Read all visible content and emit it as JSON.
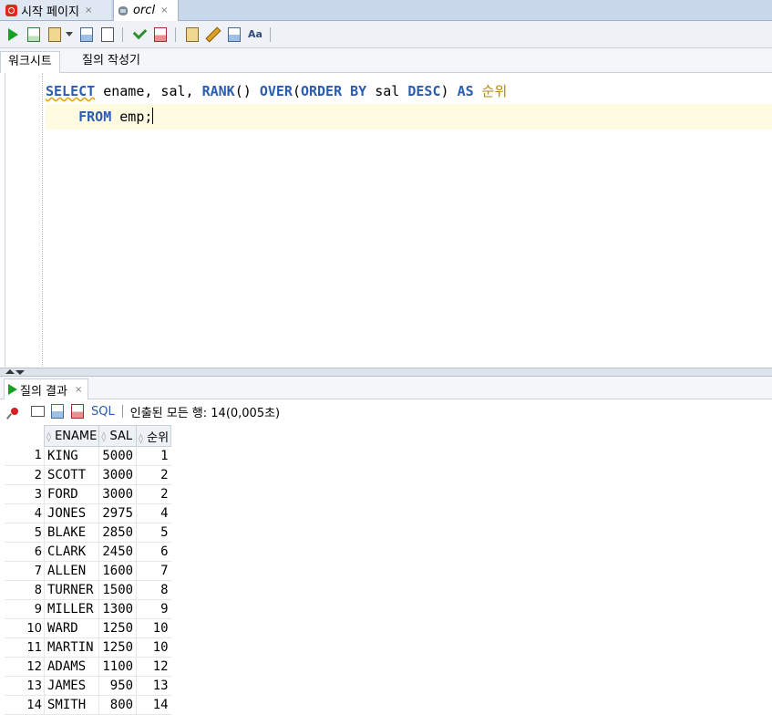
{
  "doc_tabs": [
    {
      "label": "시작 페이지",
      "close": "×"
    },
    {
      "label": "orcl",
      "close": "×"
    }
  ],
  "sub_tabs": {
    "worksheet": "워크시트",
    "query_builder": "질의 작성기"
  },
  "editor": {
    "line1": {
      "kw1": "SELECT",
      "t1": " ename, sal, ",
      "kw2": "RANK",
      "t2": "() ",
      "kw3": "OVER",
      "t3": "(",
      "kw4": "ORDER BY",
      "t4": " sal ",
      "kw5": "DESC",
      "t5": ") ",
      "kw6": "AS",
      "alias": "순위"
    },
    "line2": {
      "indent": "    ",
      "kw1": "FROM",
      "t1": " emp;"
    }
  },
  "results": {
    "tab_label": "질의 결과",
    "close": "×",
    "sql_label": "SQL",
    "status": "인출된 모든 행: 14(0,005초)",
    "columns": [
      "ENAME",
      "SAL",
      "순위"
    ],
    "rows": [
      {
        "n": "1",
        "ename": "KING",
        "sal": "5000",
        "rank": "1"
      },
      {
        "n": "2",
        "ename": "SCOTT",
        "sal": "3000",
        "rank": "2"
      },
      {
        "n": "3",
        "ename": "FORD",
        "sal": "3000",
        "rank": "2"
      },
      {
        "n": "4",
        "ename": "JONES",
        "sal": "2975",
        "rank": "4"
      },
      {
        "n": "5",
        "ename": "BLAKE",
        "sal": "2850",
        "rank": "5"
      },
      {
        "n": "6",
        "ename": "CLARK",
        "sal": "2450",
        "rank": "6"
      },
      {
        "n": "7",
        "ename": "ALLEN",
        "sal": "1600",
        "rank": "7"
      },
      {
        "n": "8",
        "ename": "TURNER",
        "sal": "1500",
        "rank": "8"
      },
      {
        "n": "9",
        "ename": "MILLER",
        "sal": "1300",
        "rank": "9"
      },
      {
        "n": "10",
        "ename": "WARD",
        "sal": "1250",
        "rank": "10"
      },
      {
        "n": "11",
        "ename": "MARTIN",
        "sal": "1250",
        "rank": "10"
      },
      {
        "n": "12",
        "ename": "ADAMS",
        "sal": "1100",
        "rank": "12"
      },
      {
        "n": "13",
        "ename": "JAMES",
        "sal": "950",
        "rank": "13"
      },
      {
        "n": "14",
        "ename": "SMITH",
        "sal": "800",
        "rank": "14"
      }
    ]
  },
  "toolbar_icons": [
    "run-statement-icon",
    "run-script-icon",
    "commit-icon",
    "dropdown-icon",
    "explain-plan-icon",
    "autotrace-icon",
    "check-icon",
    "rollback-icon",
    "sql-tuning-icon",
    "clear-icon",
    "history-icon",
    "format-icon"
  ]
}
